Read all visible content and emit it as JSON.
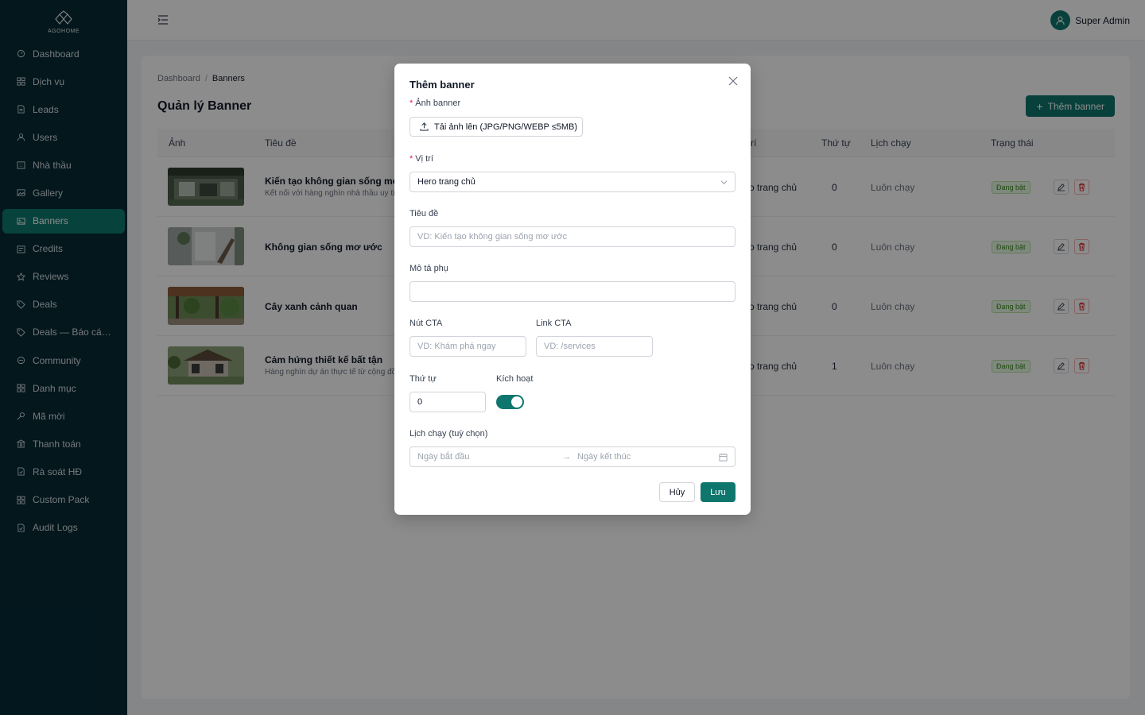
{
  "app": {
    "logo_text": "AGOHOME"
  },
  "sidebar": {
    "items": [
      {
        "label": "Dashboard",
        "icon": "dashboard-icon"
      },
      {
        "label": "Dịch vụ",
        "icon": "grid-icon"
      },
      {
        "label": "Leads",
        "icon": "file-icon"
      },
      {
        "label": "Users",
        "icon": "user-icon"
      },
      {
        "label": "Nhà thầu",
        "icon": "building-icon"
      },
      {
        "label": "Gallery",
        "icon": "image-icon"
      },
      {
        "label": "Banners",
        "icon": "picture-icon",
        "active": true
      },
      {
        "label": "Credits",
        "icon": "credit-icon"
      },
      {
        "label": "Reviews",
        "icon": "star-icon"
      },
      {
        "label": "Deals",
        "icon": "tag-icon"
      },
      {
        "label": "Deals — Báo cáo ...",
        "icon": "tag-icon"
      },
      {
        "label": "Community",
        "icon": "chat-icon"
      },
      {
        "label": "Danh mục",
        "icon": "grid-icon"
      },
      {
        "label": "Mã mời",
        "icon": "key-icon"
      },
      {
        "label": "Thanh toán",
        "icon": "bank-icon"
      },
      {
        "label": "Rà soát HĐ",
        "icon": "audit-icon"
      },
      {
        "label": "Custom Pack",
        "icon": "grid-icon"
      },
      {
        "label": "Audit Logs",
        "icon": "audit-icon"
      }
    ]
  },
  "header": {
    "user_name": "Super Admin"
  },
  "page": {
    "breadcrumb": [
      "Dashboard",
      "Banners"
    ],
    "title": "Quản lý Banner",
    "add_button": "Thêm banner"
  },
  "table": {
    "columns": [
      "Ảnh",
      "Tiêu đề",
      "rí",
      "Thứ tự",
      "Lịch chạy",
      "Trạng thái"
    ],
    "rows": [
      {
        "title": "Kiến tạo không gian sống mơ ước",
        "subtitle": "Kết nối với hàng nghìn nhà thầu uy tín",
        "position": "o trang chủ",
        "order": "0",
        "schedule": "Luôn chạy",
        "status": "Đang bật"
      },
      {
        "title": "Không gian sống mơ ước",
        "subtitle": "",
        "position": "o trang chủ",
        "order": "0",
        "schedule": "Luôn chạy",
        "status": "Đang bật"
      },
      {
        "title": "Cây xanh cảnh quan",
        "subtitle": "",
        "position": "o trang chủ",
        "order": "0",
        "schedule": "Luôn chạy",
        "status": "Đang bật"
      },
      {
        "title": "Cảm hứng thiết kế bất tận",
        "subtitle": "Hàng nghìn dự án thực tế từ cộng đồn",
        "position": "o trang chủ",
        "order": "1",
        "schedule": "Luôn chạy",
        "status": "Đang bật"
      }
    ]
  },
  "modal": {
    "title": "Thêm banner",
    "image_label": "Ảnh banner",
    "upload_label": "Tải ảnh lên (JPG/PNG/WEBP ≤5MB)",
    "position_label": "Vị trí",
    "position_value": "Hero trang chủ",
    "title_label": "Tiêu đề",
    "title_placeholder": "VD: Kiến tạo không gian sống mơ ước",
    "subtitle_label": "Mô tả phụ",
    "cta_label": "Nút CTA",
    "cta_placeholder": "VD: Khám phá ngay",
    "link_label": "Link CTA",
    "link_placeholder": "VD: /services",
    "order_label": "Thứ tự",
    "order_value": "0",
    "active_label": "Kích hoạt",
    "active": true,
    "schedule_label": "Lịch chạy (tuỳ chọn)",
    "start_placeholder": "Ngày bắt đầu",
    "end_placeholder": "Ngày kết thúc",
    "cancel": "Hủy",
    "save": "Lưu"
  },
  "colors": {
    "brand": "#0f766e",
    "sidebar_bg": "#062b36"
  }
}
